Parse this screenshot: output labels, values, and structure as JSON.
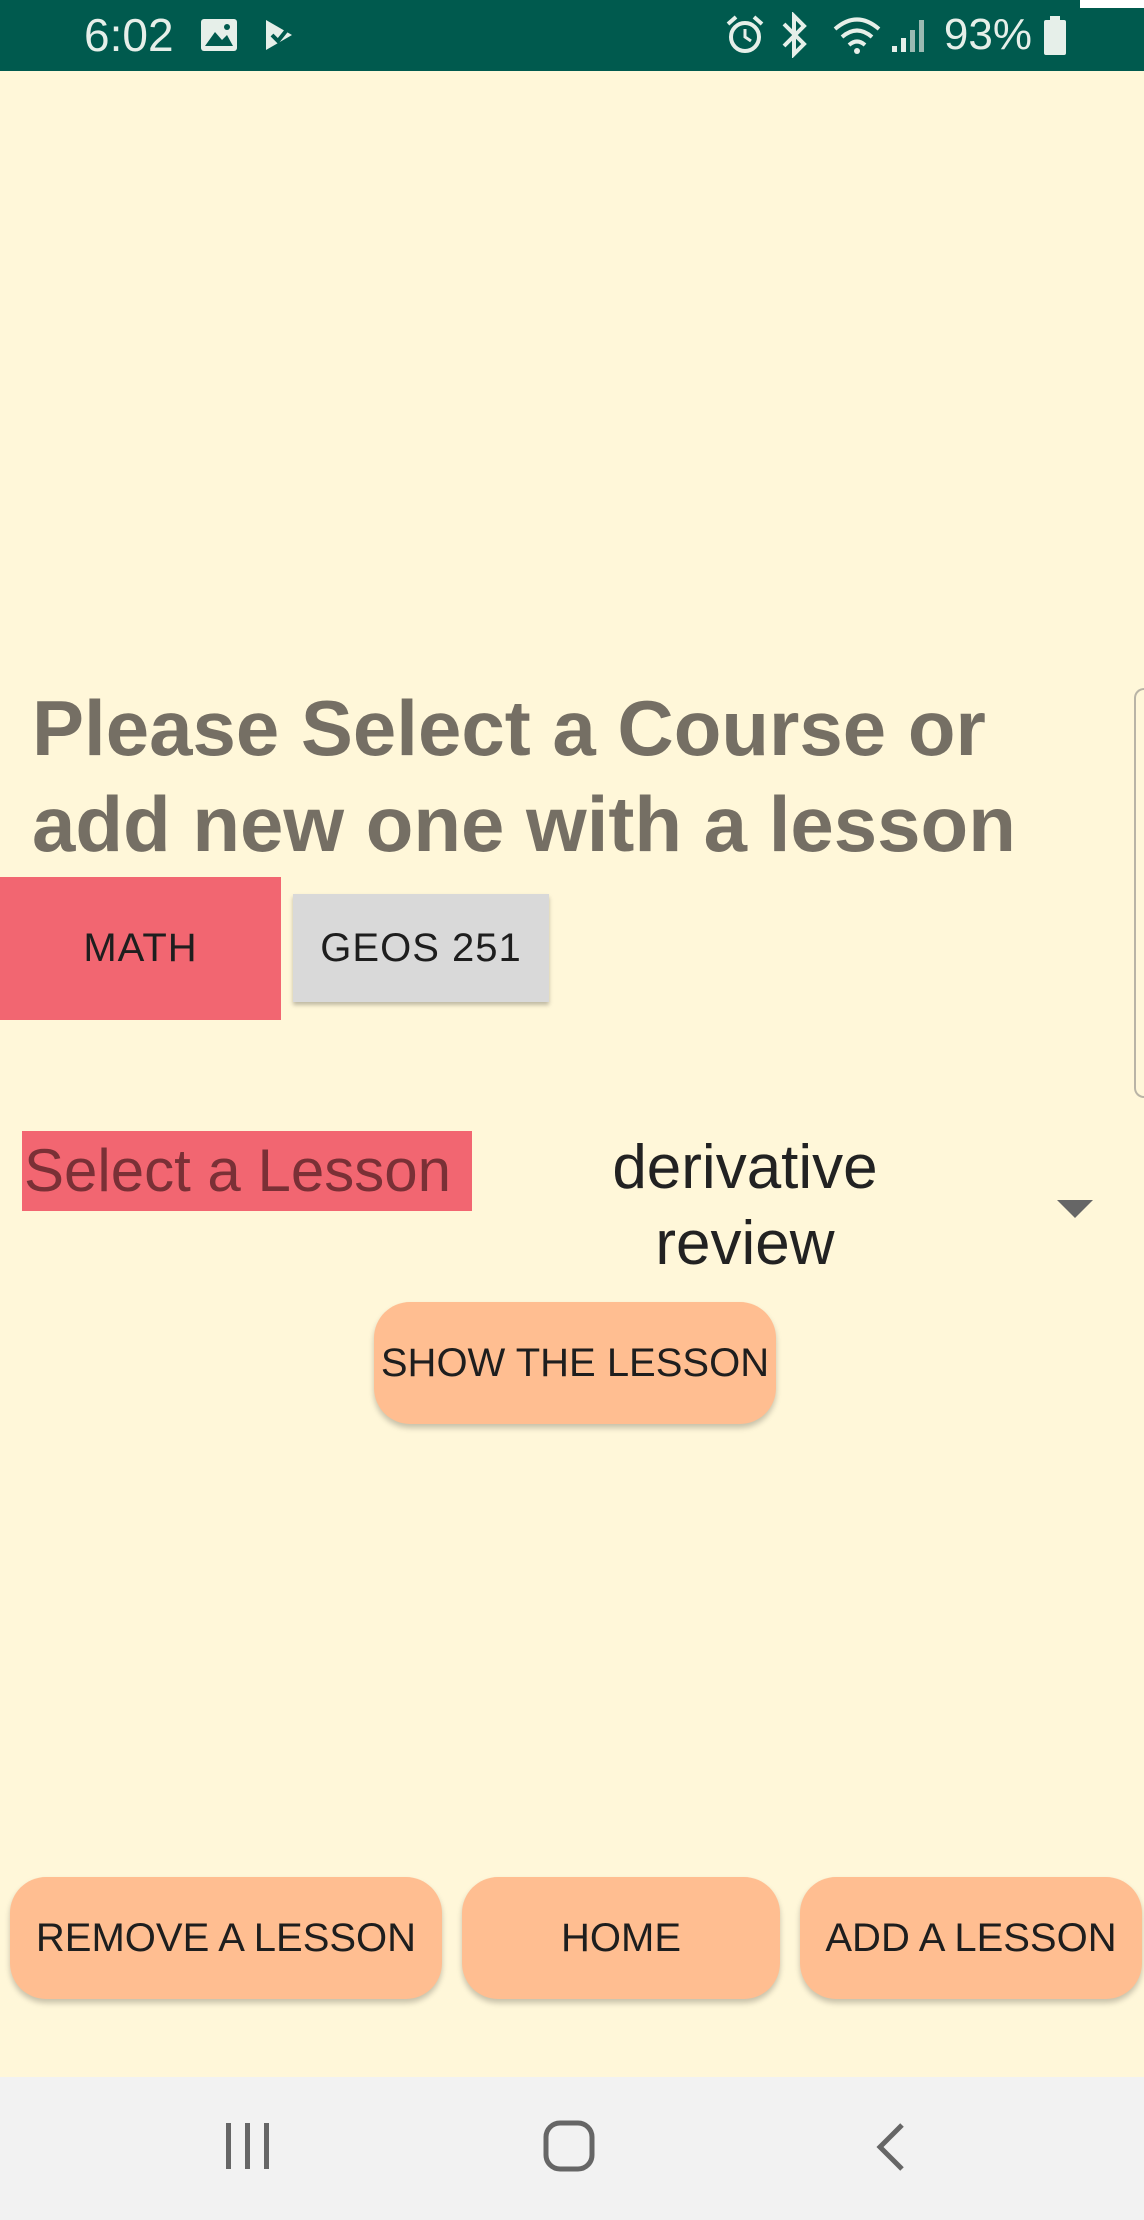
{
  "status_bar": {
    "time": "6:02",
    "battery_percent": "93%",
    "icons": [
      "image-icon",
      "check-icon",
      "alarm-icon",
      "bluetooth-icon",
      "wifi-icon",
      "signal-icon",
      "battery-icon"
    ]
  },
  "prompt": {
    "line1": "Please Select a Course or",
    "line2": "add new one with a lesson"
  },
  "courses": [
    {
      "label": "MATH",
      "selected": true
    },
    {
      "label": "GEOS 251",
      "selected": false
    }
  ],
  "lesson": {
    "label": "Select a Lesson",
    "selected_line1": "derivative",
    "selected_line2": "review"
  },
  "buttons": {
    "show": "SHOW THE LESSON",
    "remove": "REMOVE A LESSON",
    "home": "HOME",
    "add": "ADD A LESSON"
  },
  "nav": {
    "icons": [
      "recent-apps-icon",
      "home-nav-icon",
      "back-icon"
    ]
  },
  "colors": {
    "status_bar": "#005a4e",
    "background": "#fff7d9",
    "accent_red": "#f26671",
    "pill_orange": "#ffbe91",
    "prompt_text": "#756f64"
  }
}
